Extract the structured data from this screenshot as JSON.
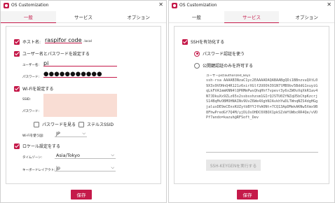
{
  "app": {
    "title": "OS Customization",
    "accent": "#c51a4a",
    "field_bg": "#f9ddd4"
  },
  "tabs": [
    "一般",
    "サービス",
    "オプション"
  ],
  "general": {
    "hostname": {
      "label": "ホスト名:",
      "value": "raspifor codesys",
      "suffix": ".local"
    },
    "user": {
      "label": "ユーザー名とパスワードを設定する",
      "username_label": "ユーザー名:",
      "username_value": "pi",
      "password_label": "パスワード:",
      "password_value": "●●●●●●●●●●●"
    },
    "wifi": {
      "label": "Wi-Fiを設定する",
      "ssid_label": "SSID:",
      "password_label": "パスワード:",
      "show_password_label": "パスワードを見る",
      "hidden_ssid_label": "ステルスSSID",
      "country_label": "Wi-Fiを使う国:",
      "country_value": "JP"
    },
    "locale": {
      "label": "ロケール設定をする",
      "timezone_label": "タイムゾーン:",
      "timezone_value": "Asia/Tokyo",
      "keyboard_label": "キーボードレイアウト:",
      "keyboard_value": "jp"
    },
    "save_label": "保存"
  },
  "services": {
    "ssh_label": "SSHを有効化する",
    "password_auth_label": "パスワード認証を使う",
    "pubkey_auth_label": "公開鍵認証のみを許可する",
    "authorized_keys_caption": "ユーザーpiのauthorized_keys",
    "authorized_keys_value": "ssh-rsa AAAAB3NzaC1yc2EAAAADAQABAABgQDi1BBnzvuQXtL09X3x9VOHnQ4R121z6xirXGlf2UOOh391N7lMB9bv5BddG1xuyiGqLkFVA1mmKNN4lQPRMmPwsQhqHhf7vpevr3y6xZW0vXqXkR1av4N7JDkuXx9ZLz65x2ssbsxhzsm1GIrQJSTU0ZfNZqU5bChpKzcrjS14BqMvOBMOHNAINv9UvZ6We4XghNJAvkhYwDLTWnqNZS4dgHGgjaluxDE9eCEnxKUZytbBYYJfhAONt+7CQ13ApDMekAKNw5Xmx9B8FhwPredGf7Q4M/yjDLOsOHDC0XBOX1pkSZsWfUWbcRR4Qe/vVDPf7ando=kazuh@RFSoft_Dev",
    "keygen_label": "SSH-KEYGENを実行する",
    "save_label": "保存"
  }
}
